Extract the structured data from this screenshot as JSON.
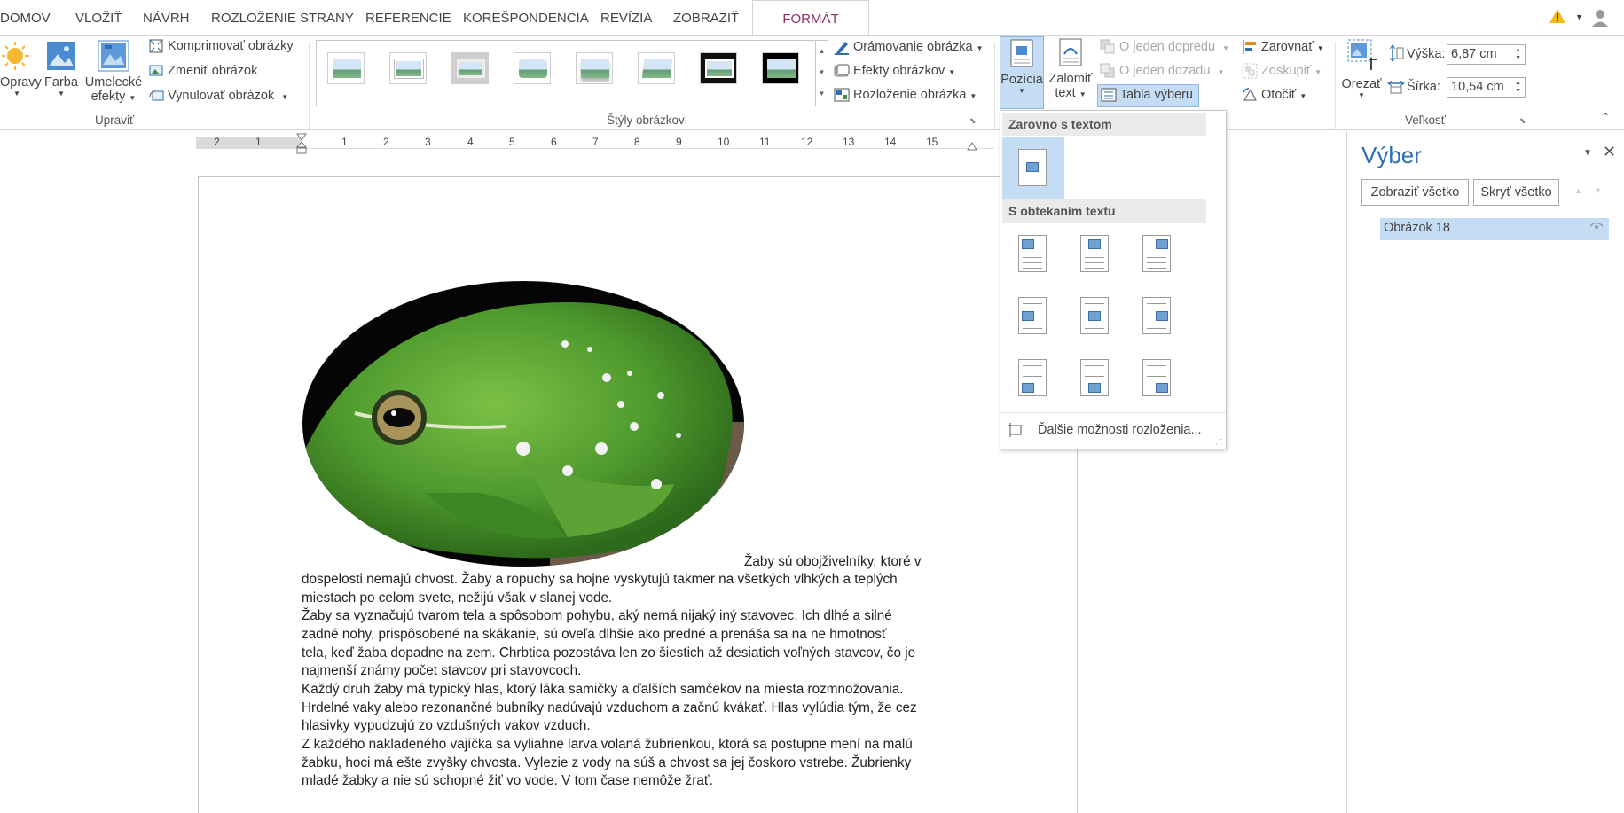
{
  "tabs": [
    "DOMOV",
    "VLOŽIŤ",
    "NÁVRH",
    "ROZLOŽENIE STRANY",
    "REFERENCIE",
    "KOREŠPONDENCIA",
    "REVÍZIA",
    "ZOBRAZIŤ",
    "FORMÁT"
  ],
  "ribbon": {
    "upravit": {
      "opravy": "Opravy",
      "farba": "Farba",
      "umelecke1": "Umelecké",
      "umelecke2": "efekty",
      "komprimovat": "Komprimovať obrázky",
      "zmenit": "Zmeniť obrázok",
      "vynulovat": "Vynulovať obrázok",
      "group": "Upraviť"
    },
    "styly": {
      "group": "Štýly obrázkov",
      "oramovanie": "Orámovanie obrázka",
      "efekty": "Efekty obrázkov",
      "rozlozenie": "Rozloženie obrázka"
    },
    "usporiadat": {
      "pozicia": "Pozícia",
      "zalomit1": "Zalomiť",
      "zalomit2": "text",
      "dopredu": "O jeden dopredu",
      "dozadu": "O jeden dozadu",
      "tabla": "Tabla výberu",
      "zarovnat": "Zarovnať",
      "zoskupit": "Zoskupiť",
      "otocit": "Otočiť"
    },
    "velkost": {
      "orezat": "Orezať",
      "vyska_label": "Výška:",
      "vyska": "6,87 cm",
      "sirka_label": "Šírka:",
      "sirka": "10,54 cm",
      "group": "Veľkosť"
    }
  },
  "ruler_numbers": [
    "2",
    "1",
    "1",
    "2",
    "3",
    "4",
    "5",
    "6",
    "7",
    "8",
    "9",
    "10",
    "11",
    "12",
    "13",
    "14",
    "15"
  ],
  "document": {
    "lines": [
      "Žaby sú obojživelníky, ktoré v",
      "dospelosti nemajú chvost. Žaby a ropuchy sa hojne vyskytujú takmer na všetkých vlhkých a teplých",
      "miestach po celom svete, nežijú však v slanej vode.",
      "Žaby sa vyznačujú tvarom tela a spôsobom pohybu, aký nemá nijaký iný stavovec. Ich dlhé a silné",
      "zadné nohy, prispôsobené na skákanie, sú oveľa dlhšie ako predné a prenáša sa na ne hmotnosť",
      "tela, keď žaba dopadne na zem. Chrbtica pozostáva len zo šiestich až desiatich voľných stavcov, čo je",
      "najmenší známy počet stavcov pri stavovcoch.",
      "Každý druh žaby má typický hlas, ktorý láka samičky a ďalších samčekov na miesta rozmnožovania.",
      "Hrdelné vaky alebo rezonančné bubníky nadúvajú vzduchom a začnú kvákať. Hlas vylúdia tým, že cez",
      "hlasivky vypudzujú zo vzdušných vakov vzduch.",
      "Z každého nakladeného vajíčka sa vyliahne larva volaná žubrienkou, ktorá sa postupne mení na malú",
      "žabku, hoci má ešte zvyšky chvosta. Vylezie z vody na súš a chvost sa jej čoskoro vstrebe. Žubrienky",
      "mladé žabky a nie sú schopné žiť vo vode. V tom čase nemôže žrať."
    ]
  },
  "dropdown": {
    "section1": "Zarovno s textom",
    "section2": "S obtekaním textu",
    "more": "Ďalšie možnosti rozloženia..."
  },
  "pane": {
    "title": "Výber",
    "show_all": "Zobraziť všetko",
    "hide_all": "Skryť všetko",
    "item": "Obrázok 18"
  },
  "colors": {
    "accent": "#8e2b63",
    "selection": "#c5dcf5",
    "frog": "#4f9a2e"
  }
}
